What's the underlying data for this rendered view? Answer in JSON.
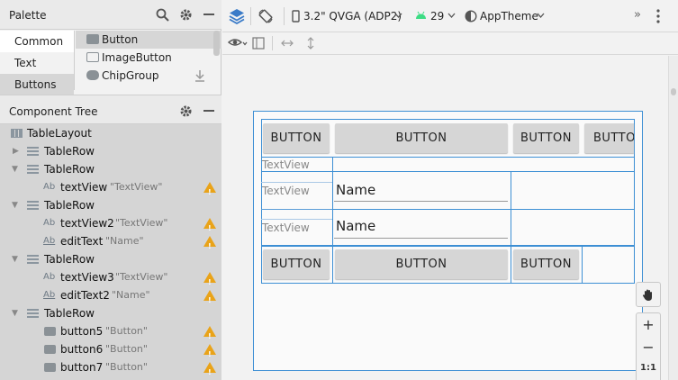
{
  "palette": {
    "title": "Palette",
    "categories": [
      "Common",
      "Text",
      "Buttons"
    ],
    "items": [
      "Button",
      "ImageButton",
      "ChipGroup"
    ]
  },
  "tree": {
    "title": "Component Tree",
    "nodes": [
      {
        "name": "TableLayout",
        "value": ""
      },
      {
        "name": "TableRow",
        "value": ""
      },
      {
        "name": "TableRow",
        "value": ""
      },
      {
        "name": "textView",
        "value": "\"TextView\""
      },
      {
        "name": "TableRow",
        "value": ""
      },
      {
        "name": "textView2",
        "value": "\"TextView\""
      },
      {
        "name": "editText",
        "value": "\"Name\""
      },
      {
        "name": "TableRow",
        "value": ""
      },
      {
        "name": "textView3",
        "value": "\"TextView\""
      },
      {
        "name": "editText2",
        "value": "\"Name\""
      },
      {
        "name": "TableRow",
        "value": ""
      },
      {
        "name": "button5",
        "value": "\"Button\""
      },
      {
        "name": "button6",
        "value": "\"Button\""
      },
      {
        "name": "button7",
        "value": "\"Button\""
      }
    ],
    "text_prefix": "Ab"
  },
  "toolbar": {
    "device": "3.2\" QVGA (ADP2)",
    "api": "29",
    "theme": "AppTheme",
    "more": "»"
  },
  "preview": {
    "row1_buttons": [
      "BUTTON",
      "BUTTON",
      "BUTTON",
      "BUTTO"
    ],
    "textview": "TextView",
    "textview2": "TextView",
    "edittext": "Name",
    "textview3": "TextView",
    "edittext2": "Name",
    "row5_buttons": [
      "BUTTON",
      "BUTTON",
      "BUTTON"
    ]
  },
  "zoom": {
    "in": "+",
    "out": "−",
    "ratio": "1:1"
  }
}
